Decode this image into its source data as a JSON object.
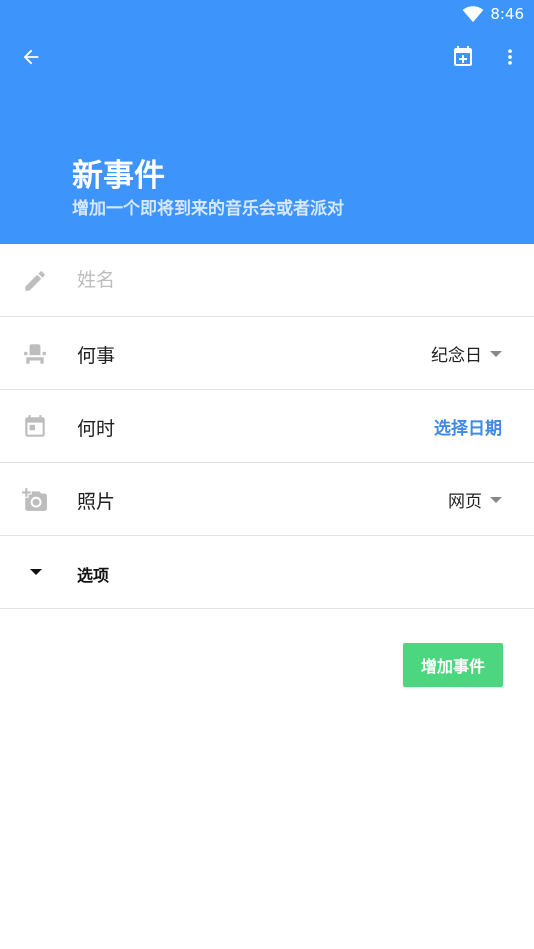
{
  "status_bar": {
    "time": "8:46",
    "wifi_icon": "wifi-icon"
  },
  "toolbar": {
    "back_icon": "arrow-left-icon",
    "calendar_add_icon": "calendar-plus-icon",
    "more_icon": "more-vert-icon"
  },
  "header": {
    "title": "新事件",
    "subtitle": "增加一个即将到来的音乐会或者派对"
  },
  "form": {
    "name": {
      "icon": "pencil-icon",
      "placeholder": "姓名",
      "value": ""
    },
    "what": {
      "icon": "seat-icon",
      "label": "何事",
      "selected": "纪念日"
    },
    "when": {
      "icon": "calendar-icon",
      "label": "何时",
      "action": "选择日期"
    },
    "photo": {
      "icon": "add-photo-icon",
      "label": "照片",
      "selected": "网页"
    },
    "options": {
      "label": "选项"
    }
  },
  "actions": {
    "add_event_label": "增加事件"
  },
  "colors": {
    "header_bg": "#3d95fb",
    "link": "#3d8ae8",
    "add_button": "#4cd67f",
    "icon_gray": "#bdbdbd"
  }
}
